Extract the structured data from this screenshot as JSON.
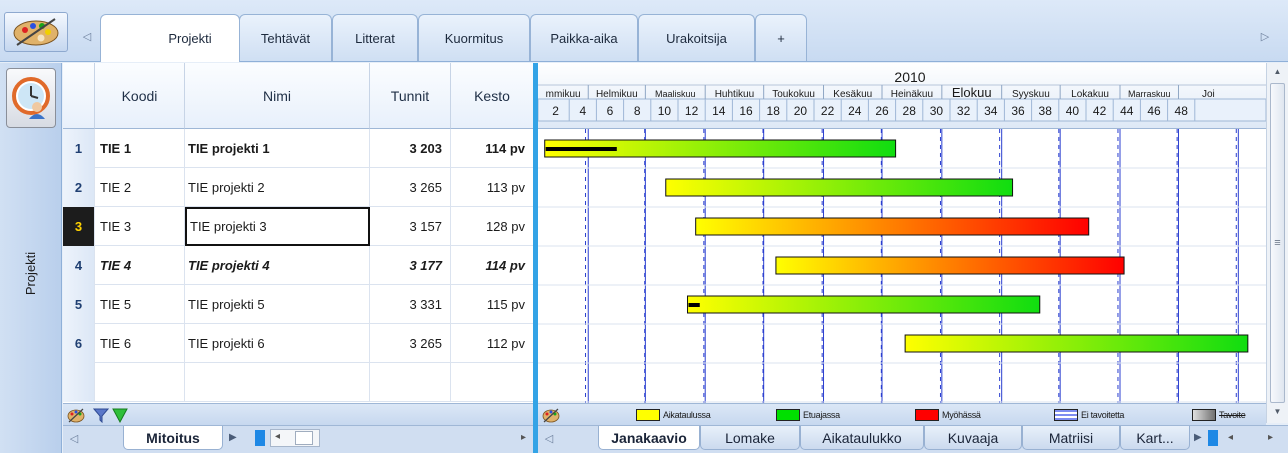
{
  "top_tabs": [
    "Projekti",
    "Tehtävät",
    "Litterat",
    "Kuormitus",
    "Paikka-aika",
    "Urakoitsija",
    "+"
  ],
  "sidebar_label": "Projekti",
  "columns": [
    "Koodi",
    "Nimi",
    "Tunnit",
    "Kesto"
  ],
  "rows": [
    {
      "num": "1",
      "koodi": "TIE 1",
      "nimi": "TIE projekti 1",
      "tunnit": "3 203",
      "kesto": "114 pv"
    },
    {
      "num": "2",
      "koodi": "TIE 2",
      "nimi": "TIE projekti 2",
      "tunnit": "3 265",
      "kesto": "113 pv"
    },
    {
      "num": "3",
      "koodi": "TIE 3",
      "nimi": "TIE projekti 3",
      "tunnit": "3 157",
      "kesto": "128 pv"
    },
    {
      "num": "4",
      "koodi": "TIE 4",
      "nimi": "TIE projekti 4",
      "tunnit": "3 177",
      "kesto": "114 pv"
    },
    {
      "num": "5",
      "koodi": "TIE 5",
      "nimi": "TIE projekti 5",
      "tunnit": "3 331",
      "kesto": "115 pv"
    },
    {
      "num": "6",
      "koodi": "TIE 6",
      "nimi": "TIE projekti 6",
      "tunnit": "3 265",
      "kesto": "112 pv"
    }
  ],
  "gantt": {
    "year": "2010",
    "months": [
      "mmikuu",
      "Helmikuu",
      "Maaliskuu",
      "Huhtikuu",
      "Toukokuu",
      "Kesäkuu",
      "Heinäkuu",
      "Elokuu",
      "Syyskuu",
      "Lokakuu",
      "Marraskuu",
      "Joi"
    ],
    "weeks": [
      "2",
      "4",
      "6",
      "8",
      "10",
      "12",
      "14",
      "16",
      "18",
      "20",
      "22",
      "24",
      "26",
      "28",
      "30",
      "32",
      "34",
      "36",
      "38",
      "40",
      "42",
      "44",
      "46",
      "48"
    ],
    "bars": [
      {
        "start_week": 1.2,
        "end_week": 27.0,
        "progress_end_week": 6.5,
        "gradient": "yellow-green"
      },
      {
        "start_week": 10.1,
        "end_week": 35.6,
        "gradient": "yellow-green"
      },
      {
        "start_week": 12.3,
        "end_week": 41.2,
        "gradient": "yellow-red"
      },
      {
        "start_week": 18.2,
        "end_week": 43.8,
        "gradient": "yellow-red"
      },
      {
        "start_week": 11.7,
        "end_week": 37.6,
        "progress_end_week": 12.6,
        "gradient": "yellow-green"
      },
      {
        "start_week": 27.7,
        "end_week": 52.9,
        "gradient": "yellow-green"
      }
    ]
  },
  "legend": [
    {
      "label": "Aikataulussa",
      "color": "#ffff00"
    },
    {
      "label": "Etuajassa",
      "color": "#00e000"
    },
    {
      "label": "Myöhässä",
      "color": "#ff0000"
    },
    {
      "label": "Ei tavoitetta",
      "color": "#7d8cf0"
    },
    {
      "label": "Tavoite",
      "color": "#8a8a8a"
    }
  ],
  "bottom_left_tabs": [
    "Mitoitus"
  ],
  "bottom_right_tabs": [
    "Janakaavio",
    "Lomake",
    "Aikataulukko",
    "Kuvaaja",
    "Matriisi",
    "Kart..."
  ],
  "colors": {
    "accent": "#33a3e6",
    "selected_row_bg": "#1c1c1c",
    "selected_row_fg": "#ffd200"
  },
  "icons": [
    "palette-icon",
    "clock-user-icon",
    "filter-icon",
    "filter-green-icon",
    "arrow-left-icon",
    "arrow-right-icon"
  ]
}
